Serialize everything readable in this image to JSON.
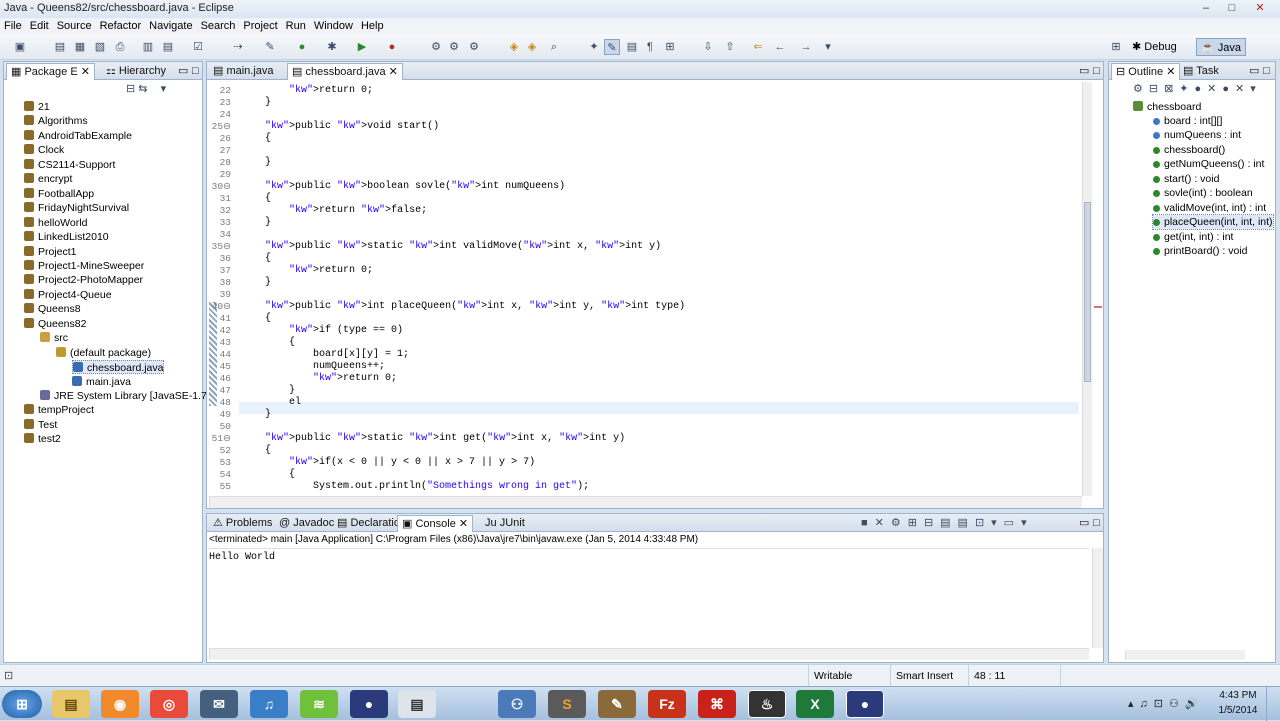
{
  "window": {
    "title": "Java - Queens82/src/chessboard.java - Eclipse",
    "minimize": "–",
    "maximize": "□",
    "close": "✕"
  },
  "menu": [
    "File",
    "Edit",
    "Source",
    "Refactor",
    "Navigate",
    "Search",
    "Project",
    "Run",
    "Window",
    "Help"
  ],
  "perspectives": {
    "debug": "Debug",
    "java": "Java"
  },
  "package_explorer": {
    "tabs": [
      "Package E",
      "Hierarchy"
    ],
    "items": [
      {
        "label": "21",
        "indent": 0,
        "kind": "project"
      },
      {
        "label": "Algorithms",
        "indent": 0,
        "kind": "project"
      },
      {
        "label": "AndroidTabExample",
        "indent": 0,
        "kind": "project"
      },
      {
        "label": "Clock",
        "indent": 0,
        "kind": "project"
      },
      {
        "label": "CS2114-Support",
        "indent": 0,
        "kind": "project"
      },
      {
        "label": "encrypt",
        "indent": 0,
        "kind": "project"
      },
      {
        "label": "FootballApp",
        "indent": 0,
        "kind": "project"
      },
      {
        "label": "FridayNightSurvival",
        "indent": 0,
        "kind": "project"
      },
      {
        "label": "helloWorld",
        "indent": 0,
        "kind": "project"
      },
      {
        "label": "LinkedList2010",
        "indent": 0,
        "kind": "project"
      },
      {
        "label": "Project1",
        "indent": 0,
        "kind": "project"
      },
      {
        "label": "Project1-MineSweeper",
        "indent": 0,
        "kind": "project"
      },
      {
        "label": "Project2-PhotoMapper",
        "indent": 0,
        "kind": "project"
      },
      {
        "label": "Project4-Queue",
        "indent": 0,
        "kind": "project"
      },
      {
        "label": "Queens8",
        "indent": 0,
        "kind": "project"
      },
      {
        "label": "Queens82",
        "indent": 0,
        "kind": "project"
      },
      {
        "label": "src",
        "indent": 1,
        "kind": "folder"
      },
      {
        "label": "(default package)",
        "indent": 2,
        "kind": "package"
      },
      {
        "label": "chessboard.java",
        "indent": 3,
        "kind": "file",
        "selected": true
      },
      {
        "label": "main.java",
        "indent": 3,
        "kind": "file"
      },
      {
        "label": "JRE System Library [JavaSE-1.7]",
        "indent": 1,
        "kind": "lib"
      },
      {
        "label": "tempProject",
        "indent": 0,
        "kind": "project"
      },
      {
        "label": "Test",
        "indent": 0,
        "kind": "project"
      },
      {
        "label": "test2",
        "indent": 0,
        "kind": "project"
      }
    ]
  },
  "editor": {
    "tabs": [
      "main.java",
      "chessboard.java"
    ],
    "lines": [
      {
        "n": "22",
        "text": "        return 0;"
      },
      {
        "n": "23",
        "text": "    }"
      },
      {
        "n": "24",
        "text": ""
      },
      {
        "n": "25⊖",
        "text": "    public void start()"
      },
      {
        "n": "26",
        "text": "    {"
      },
      {
        "n": "27",
        "text": ""
      },
      {
        "n": "28",
        "text": "    }"
      },
      {
        "n": "29",
        "text": ""
      },
      {
        "n": "30⊖",
        "text": "    public boolean sovle(int numQueens)"
      },
      {
        "n": "31",
        "text": "    {"
      },
      {
        "n": "32",
        "text": "        return false;"
      },
      {
        "n": "33",
        "text": "    }"
      },
      {
        "n": "34",
        "text": ""
      },
      {
        "n": "35⊖",
        "text": "    public static int validMove(int x, int y)"
      },
      {
        "n": "36",
        "text": "    {"
      },
      {
        "n": "37",
        "text": "        return 0;"
      },
      {
        "n": "38",
        "text": "    }"
      },
      {
        "n": "39",
        "text": ""
      },
      {
        "n": "40⊖",
        "text": "    public int placeQueen(int x, int y, int type)"
      },
      {
        "n": "41",
        "text": "    {"
      },
      {
        "n": "42",
        "text": "        if (type == 0)"
      },
      {
        "n": "43",
        "text": "        {"
      },
      {
        "n": "44",
        "text": "            board[x][y] = 1;"
      },
      {
        "n": "45",
        "text": "            numQueens++;"
      },
      {
        "n": "46",
        "text": "            return 0;"
      },
      {
        "n": "47",
        "text": "        }"
      },
      {
        "n": "48",
        "text": "        el"
      },
      {
        "n": "49",
        "text": "    }"
      },
      {
        "n": "50",
        "text": ""
      },
      {
        "n": "51⊖",
        "text": "    public static int get(int x, int y)"
      },
      {
        "n": "52",
        "text": "    {"
      },
      {
        "n": "53",
        "text": "        if(x < 0 || y < 0 || x > 7 || y > 7)"
      },
      {
        "n": "54",
        "text": "        {"
      },
      {
        "n": "55",
        "text": "            System.out.println(\"Somethings wrong in get\");"
      }
    ]
  },
  "outline": {
    "tabs": [
      "Outline",
      "Task"
    ],
    "root": "chessboard",
    "items": [
      "board : int[][]",
      "numQueens : int",
      "chessboard()",
      "getNumQueens() : int",
      "start() : void",
      "sovle(int) : boolean",
      "validMove(int, int) : int",
      "placeQueen(int, int, int)",
      "get(int, int) : int",
      "printBoard() : void"
    ]
  },
  "console": {
    "tabs": [
      "Problems",
      "Javadoc",
      "Declaration",
      "Console",
      "JUnit"
    ],
    "header": "<terminated> main [Java Application] C:\\Program Files (x86)\\Java\\jre7\\bin\\javaw.exe (Jan 5, 2014 4:33:48 PM)",
    "output": "Hello World"
  },
  "status": {
    "writable": "Writable",
    "insert_mode": "Smart Insert",
    "position": "48 : 11"
  },
  "clock": {
    "time": "4:43 PM",
    "date": "1/5/2014"
  },
  "taskbar_apps": [
    "start",
    "explorer",
    "firefox",
    "chrome",
    "mail",
    "itunes",
    "spotify",
    "eclipse-globe",
    "notepad",
    "network",
    "sublime",
    "app",
    "filezilla",
    "acrobat",
    "steam",
    "excel",
    "eclipse"
  ]
}
